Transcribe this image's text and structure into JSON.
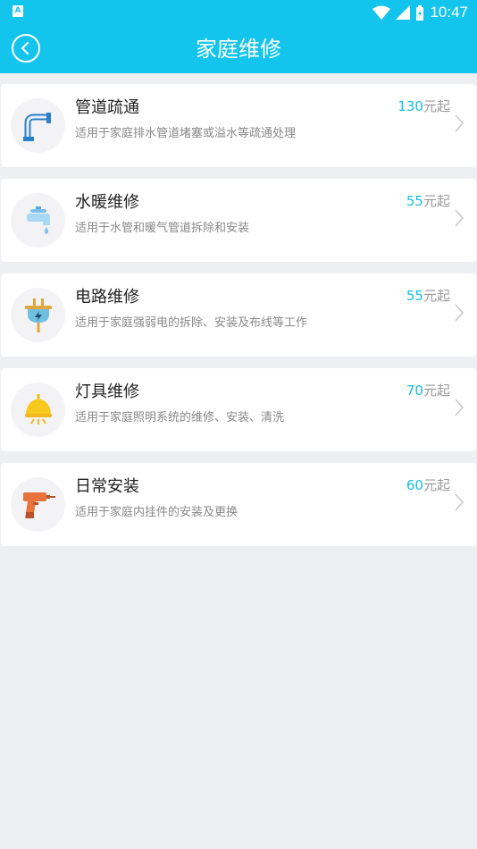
{
  "status_bar": {
    "time": "10:47",
    "app_badge": "A"
  },
  "header": {
    "title": "家庭维修"
  },
  "colors": {
    "accent": "#13c4ec",
    "price": "#13bde6"
  },
  "services": [
    {
      "icon": "pipe-icon",
      "title": "管道疏通",
      "desc": "适用于家庭排水管道堵塞或溢水等疏通处理",
      "price": "130",
      "price_suffix": "元起"
    },
    {
      "icon": "faucet-icon",
      "title": "水暖维修",
      "desc": "适用于水管和暖气管道拆除和安装",
      "price": "55",
      "price_suffix": "元起"
    },
    {
      "icon": "plug-icon",
      "title": "电路维修",
      "desc": "适用于家庭强弱电的拆除、安装及布线等工作",
      "price": "55",
      "price_suffix": "元起"
    },
    {
      "icon": "lamp-icon",
      "title": "灯具维修",
      "desc": "适用于家庭照明系统的维修、安装、清洗",
      "price": "70",
      "price_suffix": "元起"
    },
    {
      "icon": "drill-icon",
      "title": "日常安装",
      "desc": "适用于家庭内挂件的安装及更换",
      "price": "60",
      "price_suffix": "元起"
    }
  ]
}
